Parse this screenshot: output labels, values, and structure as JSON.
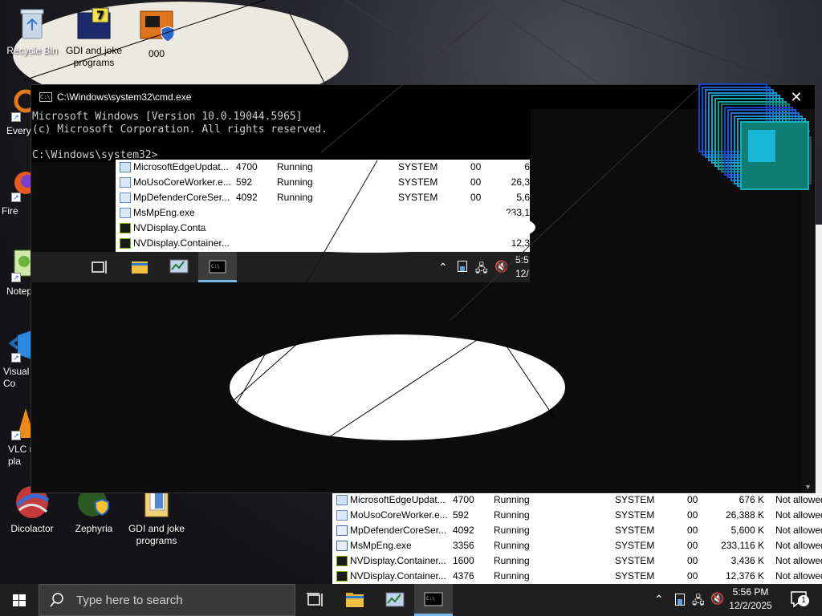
{
  "desktop": {
    "icons": [
      {
        "label": "Recycle Bin"
      },
      {
        "label": "GDI and joke programs"
      },
      {
        "label": "000"
      },
      {
        "label": "Every"
      },
      {
        "label": "Fire"
      },
      {
        "label": "Notep"
      },
      {
        "label": "Visual Co"
      },
      {
        "label": "VLC r pla"
      },
      {
        "label": "Dicolactor"
      },
      {
        "label": "Zephyria"
      },
      {
        "label": "GDI and joke programs"
      }
    ]
  },
  "cmd": {
    "title": "C:\\Windows\\system32\\cmd.exe",
    "close_label": "✕",
    "lines": [
      "Microsoft Windows [Version 10.0.19044.5965]",
      "(c) Microsoft Corporation. All rights reserved.",
      "",
      "C:\\Windows\\system32>"
    ]
  },
  "task_manager": {
    "rows": [
      {
        "name": "MicrosoftEdgeUpdat...",
        "pid": "4700",
        "status": "Running",
        "user": "SYSTEM",
        "cpu": "00",
        "memory": "676 K",
        "uac": "Not allowed",
        "icon": "edge"
      },
      {
        "name": "MoUsoCoreWorker.e...",
        "pid": "592",
        "status": "Running",
        "user": "SYSTEM",
        "cpu": "00",
        "memory": "26,388 K",
        "uac": "Not allowed",
        "icon": "app"
      },
      {
        "name": "MpDefenderCoreSer...",
        "pid": "4092",
        "status": "Running",
        "user": "SYSTEM",
        "cpu": "00",
        "memory": "5,600 K",
        "uac": "Not allowed",
        "icon": "def"
      },
      {
        "name": "MsMpEng.exe",
        "pid": "3356",
        "status": "Running",
        "user": "SYSTEM",
        "cpu": "00",
        "memory": "233,116 K",
        "uac": "Not allowed",
        "icon": "def"
      },
      {
        "name": "NVDisplay.Container...",
        "pid": "1600",
        "status": "Running",
        "user": "SYSTEM",
        "cpu": "00",
        "memory": "3,436 K",
        "uac": "Not allowed",
        "icon": "nv"
      },
      {
        "name": "NVDisplay.Container...",
        "pid": "4376",
        "status": "Running",
        "user": "SYSTEM",
        "cpu": "00",
        "memory": "12,376 K",
        "uac": "Not allowed",
        "icon": "nv"
      }
    ],
    "ghost_rows": [
      {
        "name": "MicrosoftEdgeUpdat...",
        "pid": "4700",
        "status": "Running",
        "user": "SYSTEM",
        "cpu": "00",
        "memory": "6"
      },
      {
        "name": "MoUsoCoreWorker.e...",
        "pid": "592",
        "status": "Running",
        "user": "SYSTEM",
        "cpu": "00",
        "memory": "26,3"
      },
      {
        "name": "MpDefenderCoreSer...",
        "pid": "4092",
        "status": "Running",
        "user": "SYSTEM",
        "cpu": "00",
        "memory": "5,6"
      },
      {
        "name": "MsMpEng.exe",
        "pid": "",
        "status": "",
        "user": "",
        "cpu": "",
        "memory": "233,1"
      },
      {
        "name": "NVDisplay.Contai",
        "pid": "",
        "status": "",
        "user": "",
        "cpu": "",
        "memory": ""
      },
      {
        "name": "NVDisplay.Container...",
        "pid": "",
        "status": "",
        "user": "",
        "cpu": "",
        "memory": "12,3"
      }
    ]
  },
  "taskbar": {
    "search_placeholder": "Type here to search",
    "time": "5:56 PM",
    "date": "12/2/2025",
    "ghost_time": "5:5",
    "ghost_date": "12/",
    "notification_count": "1"
  },
  "colors": {
    "taskbar_bg": "#1f1f1f",
    "accent": "#76b9ed",
    "cmd_bg": "#0c0c0c"
  }
}
